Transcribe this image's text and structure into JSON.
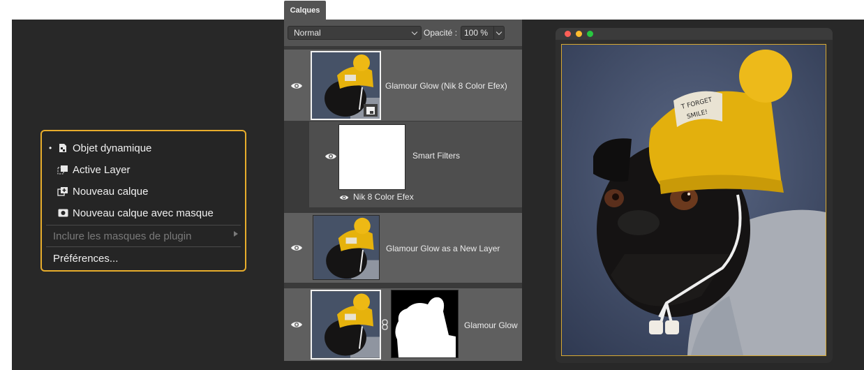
{
  "context_menu": {
    "items": [
      {
        "label": "Objet dynamique",
        "checked": true,
        "icon": "smart-object-icon"
      },
      {
        "label": "Active Layer",
        "checked": false,
        "icon": "active-layer-icon"
      },
      {
        "label": "Nouveau calque",
        "checked": false,
        "icon": "new-layer-icon"
      },
      {
        "label": "Nouveau calque avec masque",
        "checked": false,
        "icon": "new-layer-mask-icon"
      }
    ],
    "include_masks": "Inclure les masques de plugin",
    "preferences": "Préférences..."
  },
  "layers_panel": {
    "tab_label": "Calques",
    "blend_mode": "Normal",
    "opacity_label": "Opacité :",
    "opacity_value": "100 %",
    "layers": [
      {
        "name": "Glamour Glow (Nik 8 Color Efex)",
        "visible": true,
        "smart_object": true
      },
      {
        "name": "Smart Filters",
        "visible": true,
        "filter_name": "Nik 8 Color Efex"
      },
      {
        "name": "Glamour Glow as a New Layer",
        "visible": true
      },
      {
        "name": "Glamour Glow",
        "visible": true,
        "has_mask": true
      }
    ]
  },
  "document_window": {
    "traffic_lights": [
      "#fe5f57",
      "#febc2e",
      "#28c840"
    ]
  },
  "colors": {
    "accent": "#e8ad2c",
    "panel": "#535353",
    "background": "#282828"
  }
}
